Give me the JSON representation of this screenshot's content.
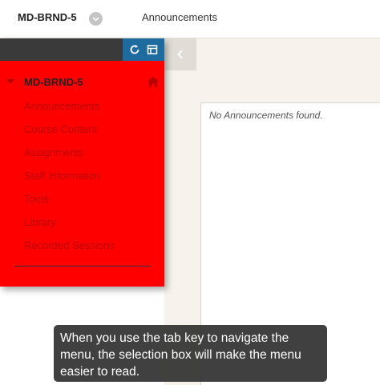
{
  "breadcrumb": {
    "course_id": "MD-BRND-5",
    "current_page": "Announcements"
  },
  "course_menu": {
    "title": "MD-BRND-5",
    "items": [
      {
        "label": "Announcements"
      },
      {
        "label": "Course Content"
      },
      {
        "label": "Assignments"
      },
      {
        "label": "Staff Information"
      },
      {
        "label": "Tools"
      },
      {
        "label": "Library"
      },
      {
        "label": "Recorded Sessions"
      }
    ],
    "background_color": "#ff0000",
    "text_color": "#b80000"
  },
  "icons": {
    "refresh": "refresh-icon",
    "layout": "display-toggle-icon",
    "home": "home-icon",
    "collapse": "chevron-left-icon",
    "toggle": "chevron-down-icon"
  },
  "content": {
    "empty_message": "No Announcements found."
  },
  "caption": {
    "text": "When you use the tab key to navigate the menu, the selection box will make the menu easier to read."
  },
  "colors": {
    "toolbar_blue": "#1e6ba0",
    "header_dark": "#3a3a3a",
    "page_bg": "#f7f3ec"
  }
}
